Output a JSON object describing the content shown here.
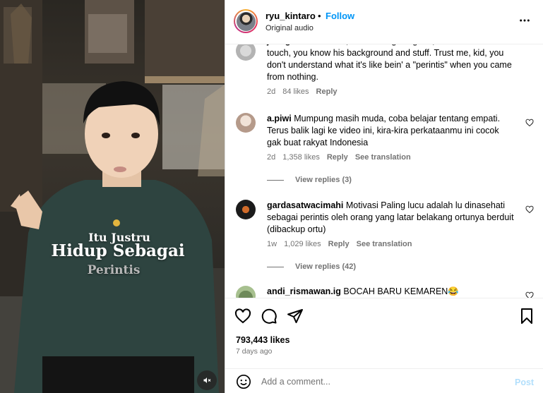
{
  "post": {
    "username": "ryu_kintaro",
    "separator": "•",
    "follow_label": "Follow",
    "audio": "Original audio",
    "more_icon": "more-horizontal-icon"
  },
  "video": {
    "caption_line1": "Itu Justru",
    "caption_line2": "Hidup Sebagai",
    "caption_line3": "Perintis",
    "mute_icon": "muted-speaker-icon"
  },
  "comments": [
    {
      "username": "jadugarmeli",
      "text": "I mean, the message is good, but it seems out of touch, you know his background and stuff. Trust me, kid, you don't understand what it's like bein' a \"perintis\" when you came from nothing.",
      "time": "2d",
      "likes": "84 likes",
      "reply": "Reply",
      "translation": ""
    },
    {
      "username": "a.piwi",
      "text": "Mumpung masih muda, coba belajar tentang empati. Terus balik lagi ke video ini, kira-kira perkataanmu ini cocok gak buat rakyat Indonesia",
      "time": "2d",
      "likes": "1,358 likes",
      "reply": "Reply",
      "translation": "See translation",
      "view_replies": "View replies (3)"
    },
    {
      "username": "gardasatwacimahi",
      "text": "Motivasi Paling lucu adalah lu dinasehati sebagai perintis oleh orang yang latar belakang ortunya berduit (dibackup ortu)",
      "time": "1w",
      "likes": "1,029 likes",
      "reply": "Reply",
      "translation": "See translation",
      "view_replies": "View replies (42)"
    },
    {
      "username": "andi_rismawan.ig",
      "text": "BOCAH BARU KEMAREN😂"
    }
  ],
  "actions": {
    "like_icon": "heart-icon",
    "comment_icon": "comment-bubble-icon",
    "share_icon": "paper-plane-icon",
    "save_icon": "bookmark-icon",
    "likes": "793,443 likes",
    "date": "7 days ago"
  },
  "composer": {
    "placeholder": "Add a comment...",
    "post_label": "Post",
    "emoji_icon": "smiley-icon"
  },
  "colors": {
    "accent": "#0095f6",
    "post_disabled": "#b2dffc",
    "muted_text": "#737373"
  }
}
